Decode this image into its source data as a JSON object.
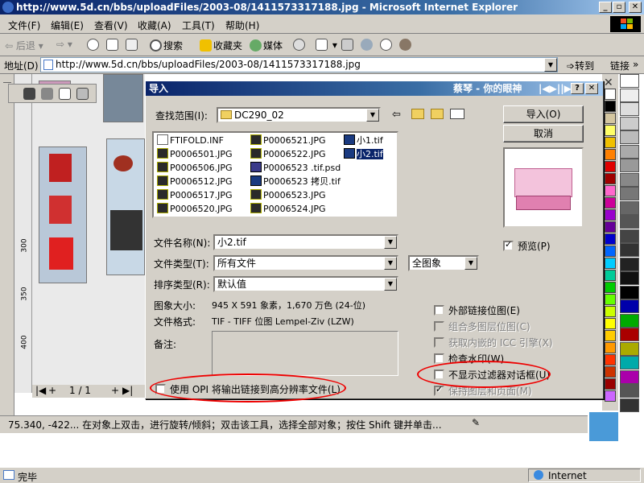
{
  "browser": {
    "title": "http://www.5d.cn/bbs/uploadFiles/2003-08/1411573317188.jpg - Microsoft Internet Explorer",
    "window_buttons": [
      "_",
      "▫",
      "✕"
    ],
    "menu": [
      "文件(F)",
      "编辑(E)",
      "查看(V)",
      "收藏(A)",
      "工具(T)",
      "帮助(H)"
    ],
    "toolbar": {
      "back": "后退",
      "search": "搜索",
      "favorites": "收藏夹",
      "media": "媒体"
    },
    "address": {
      "label": "地址(D)",
      "url": "http://www.5d.cn/bbs/uploadFiles/2003-08/1411573317188.jpg",
      "go": "转到",
      "links": "链接"
    },
    "status": {
      "text": "完毕",
      "zone": "Internet"
    }
  },
  "corel": {
    "page_nav": "1 / 1",
    "status_text": "75.340, -422... 在对象上双击，进行旋转/倾斜；双击该工具，选择全部对象；按住 Shift 键并单击...",
    "ruler": [
      "300",
      "350",
      "400"
    ],
    "palette_colors": [
      "#ffffff",
      "#000000",
      "#d4c6a0",
      "#ffff66",
      "#f0c000",
      "#ff8000",
      "#e00000",
      "#a00000",
      "#ff66cc",
      "#cc0099",
      "#9900cc",
      "#660099",
      "#0000cc",
      "#0066ff",
      "#00ccff",
      "#00cc99",
      "#00cc00",
      "#66ff00",
      "#ccff00",
      "#ffff00",
      "#ffcc00",
      "#ff9900",
      "#ff3300",
      "#cc3300",
      "#990000",
      "#cc66ff"
    ],
    "gray_colors": [
      "#ffffff",
      "#eeeeee",
      "#dddddd",
      "#cccccc",
      "#bbbbbb",
      "#aaaaaa",
      "#999999",
      "#888888",
      "#777777",
      "#666666",
      "#555555",
      "#444444",
      "#333333",
      "#222222",
      "#111111",
      "#000000",
      "#0000aa",
      "#00aa00",
      "#aa0000",
      "#aaaa00",
      "#00aaaa",
      "#aa00aa",
      "#555555",
      "#333333"
    ]
  },
  "dialog": {
    "title": "导入",
    "title_extra": "蔡琴 - 你的眼神",
    "look_in_label": "查找范围(I):",
    "look_in_value": "DC290_02",
    "files": [
      {
        "name": "FTIFOLD.INF",
        "type": "inf"
      },
      {
        "name": "P0006501.JPG",
        "type": "jpg"
      },
      {
        "name": "P0006506.JPG",
        "type": "jpg"
      },
      {
        "name": "P0006512.JPG",
        "type": "jpg"
      },
      {
        "name": "P0006517.JPG",
        "type": "jpg"
      },
      {
        "name": "P0006520.JPG",
        "type": "jpg"
      },
      {
        "name": "P0006521.JPG",
        "type": "jpg"
      },
      {
        "name": "P0006522.JPG",
        "type": "jpg"
      },
      {
        "name": "P0006523 .tif.psd",
        "type": "psd"
      },
      {
        "name": "P0006523 拷贝.tif",
        "type": "tif"
      },
      {
        "name": "P0006523.JPG",
        "type": "jpg"
      },
      {
        "name": "P0006524.JPG",
        "type": "jpg"
      },
      {
        "name": "小1.tif",
        "type": "tif"
      },
      {
        "name": "小2.tif",
        "type": "tif",
        "selected": true
      }
    ],
    "filename_label": "文件名称(N):",
    "filename_value": "小2.tif",
    "filetype_label": "文件类型(T):",
    "filetype_value": "所有文件",
    "sort_label": "排序类型(R):",
    "sort_value": "默认值",
    "image_combo": "全图象",
    "size_label": "图象大小:",
    "size_value": "945 X 591 象素，1,670 万色 (24-位)",
    "format_label": "文件格式:",
    "format_value": "TIF - TIFF 位图 Lempel-Ziv (LZW)",
    "notes_label": "备注:",
    "import_button": "导入(O)",
    "cancel_button": "取消",
    "preview_label": "预览(P)",
    "options": [
      {
        "label": "外部链接位图(E)",
        "checked": false,
        "disabled": false
      },
      {
        "label": "组合多图层位图(C)",
        "checked": false,
        "disabled": true
      },
      {
        "label": "获取内嵌的 ICC 引擎(X)",
        "checked": false,
        "disabled": true
      },
      {
        "label": "检查水印(W)",
        "checked": false,
        "disabled": false
      },
      {
        "label": "不显示过滤器对话框(U)",
        "checked": false,
        "disabled": false
      },
      {
        "label": "保持图层和页面(M)",
        "checked": true,
        "disabled": true
      }
    ],
    "opi_label": "使用 OPI 将输出链接到高分辨率文件(L)"
  }
}
